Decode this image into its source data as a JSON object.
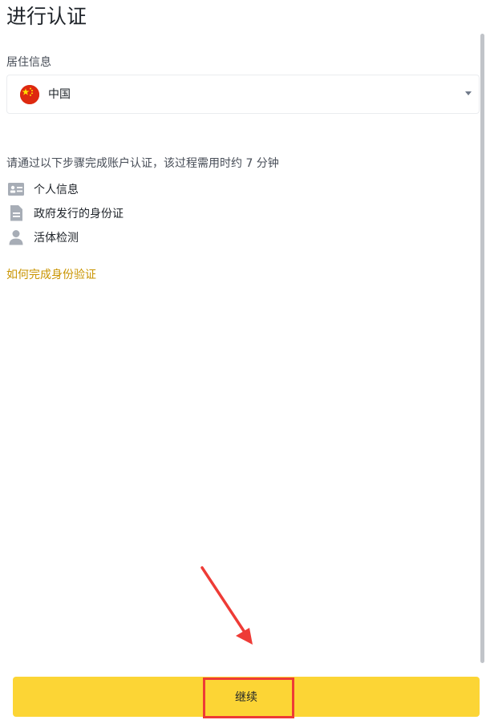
{
  "page": {
    "title": "进行认证"
  },
  "residence": {
    "label": "居住信息",
    "selected_country": "中国",
    "flag": "china-flag-icon"
  },
  "verification": {
    "intro": "请通过以下步骤完成账户认证，该过程需用时约 7 分钟",
    "steps": [
      {
        "icon": "id-card-icon",
        "label": "个人信息"
      },
      {
        "icon": "document-icon",
        "label": "政府发行的身份证"
      },
      {
        "icon": "person-icon",
        "label": "活体检测"
      }
    ],
    "help_link": "如何完成身份验证"
  },
  "footer": {
    "continue_label": "继续"
  },
  "colors": {
    "accent": "#fcd535",
    "link": "#c99400",
    "annotation": "#ee3b36"
  }
}
